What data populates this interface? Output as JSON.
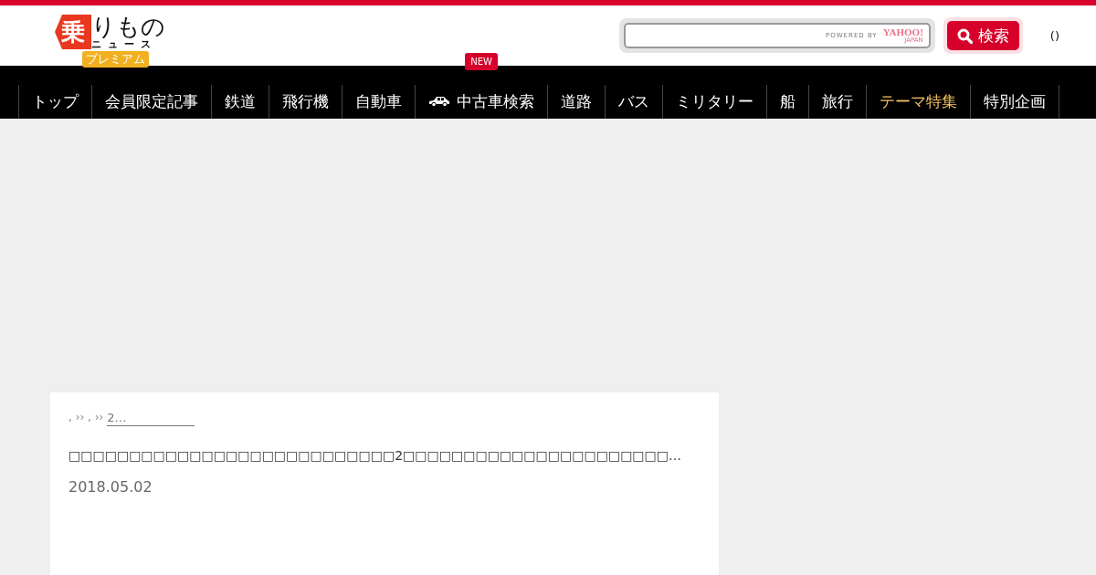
{
  "header": {
    "logo": {
      "mark": "乗",
      "name": "りもの",
      "subname": "ニュース",
      "badge": "プレミアム"
    },
    "search": {
      "powered_by": "POWERED BY",
      "provider": "YAHOO!",
      "provider_region": "JAPAN",
      "button": "検索"
    },
    "user_link": "()"
  },
  "nav": [
    {
      "label": "トップ",
      "kind": "normal"
    },
    {
      "label": "会員限定記事",
      "kind": "normal"
    },
    {
      "label": "鉄道",
      "kind": "normal"
    },
    {
      "label": "飛行機",
      "kind": "normal"
    },
    {
      "label": "自動車",
      "kind": "normal"
    },
    {
      "label": "中古車検索",
      "kind": "car",
      "badge": "NEW"
    },
    {
      "label": "道路",
      "kind": "normal"
    },
    {
      "label": "バス",
      "kind": "normal"
    },
    {
      "label": "ミリタリー",
      "kind": "normal"
    },
    {
      "label": "船",
      "kind": "normal"
    },
    {
      "label": "旅行",
      "kind": "normal"
    },
    {
      "label": "テーマ特集",
      "kind": "featured"
    },
    {
      "label": "特別企画",
      "kind": "normal"
    }
  ],
  "article": {
    "breadcrumb": ", ›› , ››",
    "breadcrumb_link": "2…",
    "title": "□□□□□□□□□□□□□□□□□□□□□□□□□□□2□□□□□□□□□□□□□□□□□□□□□□…",
    "date": "2018.05.02"
  }
}
